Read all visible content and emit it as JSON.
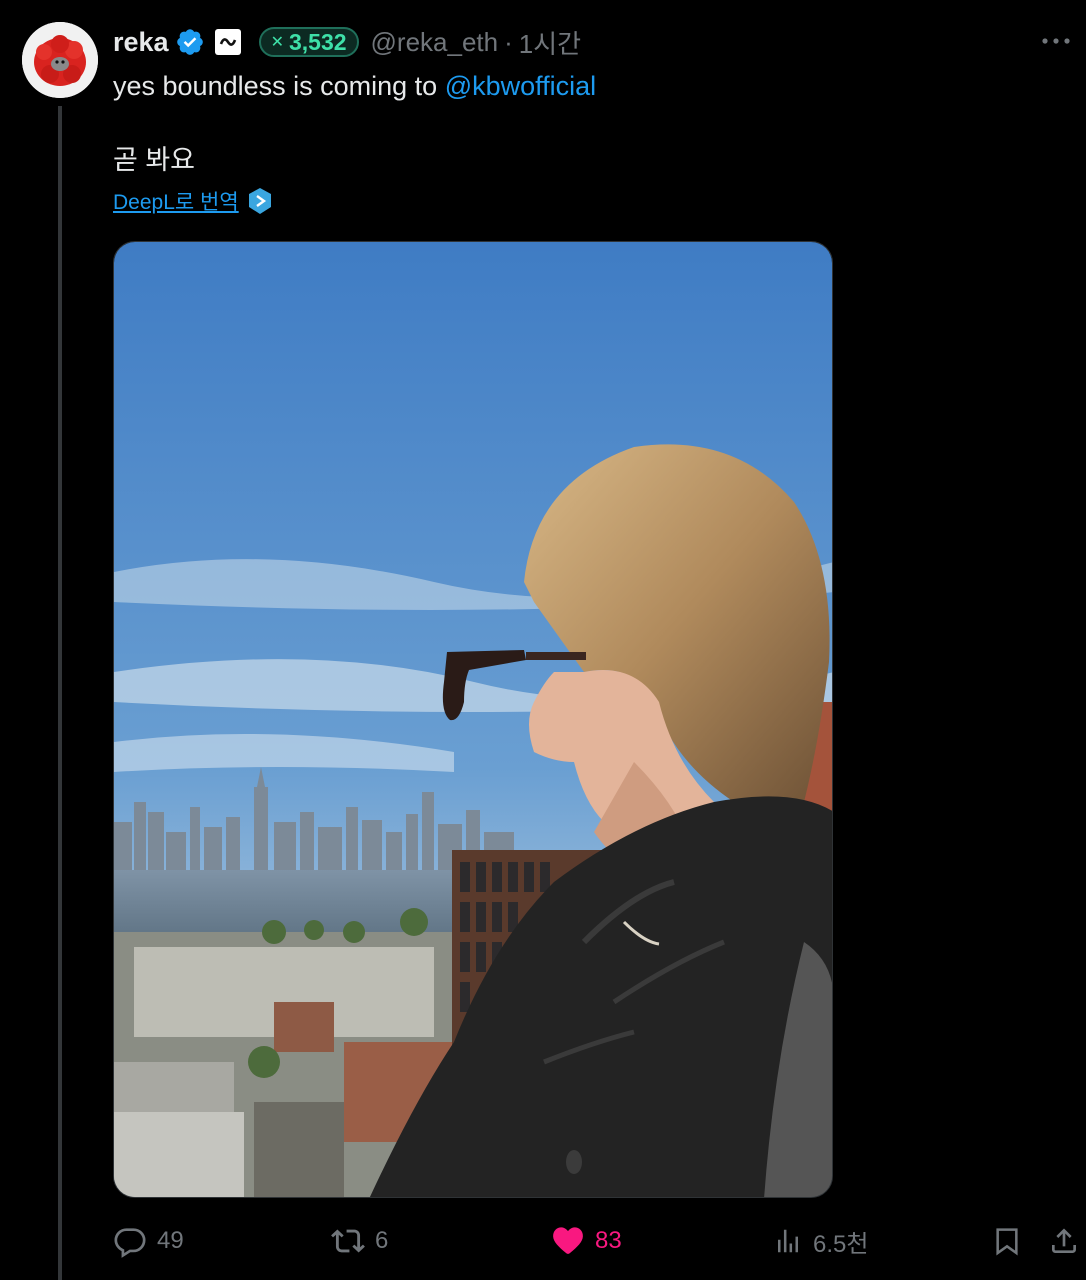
{
  "post": {
    "author": {
      "display_name": "reka",
      "handle": "@reka_eth",
      "score_badge": "3,532"
    },
    "timestamp": "1시간",
    "separator": "·",
    "text_line1_prefix": "yes boundless is coming to ",
    "mention": "@kbwofficial",
    "text_line2": "곧 봐요",
    "translate_label": "DeepL로 번역",
    "media": {
      "type": "photo"
    }
  },
  "actions": {
    "replies": "49",
    "reposts": "6",
    "likes": "83",
    "views": "6.5천"
  },
  "colors": {
    "accent": "#1d9bf0",
    "like": "#f91880",
    "score_green": "#3ee0a8",
    "muted": "#71767b",
    "background": "#000000"
  },
  "icons": [
    "verified-badge-icon",
    "affiliate-badge-icon",
    "more-icon",
    "deepl-icon",
    "reply-icon",
    "repost-icon",
    "heart-icon",
    "views-icon",
    "bookmark-icon",
    "share-icon"
  ]
}
